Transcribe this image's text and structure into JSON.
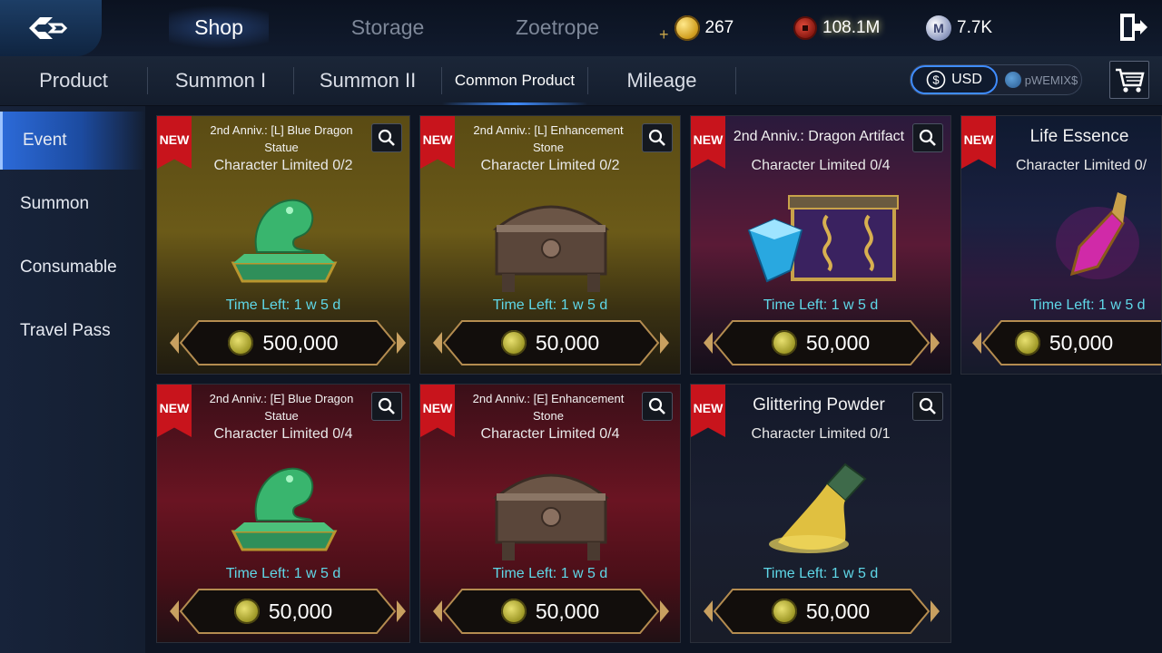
{
  "top_tabs": [
    "Shop",
    "Storage",
    "Zoetrope"
  ],
  "currencies": {
    "gold": "267",
    "red": "108.1M",
    "silver": "7.7K",
    "silver_glyph": "M",
    "gold_plus": "+"
  },
  "sub_tabs": [
    "Product",
    "Summon I",
    "Summon II",
    "Common Product",
    "Mileage"
  ],
  "currency_toggle": {
    "usd": "USD",
    "wemix": "pWEMIX$"
  },
  "sidebar": [
    "Event",
    "Summon",
    "Consumable",
    "Travel Pass"
  ],
  "badge": "NEW",
  "cards": [
    {
      "title": "2nd Anniv.: [L] Blue Dragon Statue",
      "limit": "Character Limited 0/2",
      "time": "Time Left: 1 w 5 d",
      "price": "500,000",
      "icon": "jade-dragon-statue"
    },
    {
      "title": "2nd Anniv.: [L] Enhancement Stone",
      "limit": "Character Limited 0/2",
      "time": "Time Left: 1 w 5 d",
      "price": "50,000",
      "icon": "bronze-chest"
    },
    {
      "title": "2nd Anniv.: Dragon Artifact",
      "limit": "Character Limited 0/4",
      "time": "Time Left: 1 w 5 d",
      "price": "50,000",
      "icon": "gem-and-dragon-chest"
    },
    {
      "title": "Life Essence",
      "limit": "Character Limited 0/",
      "time": "Time Left: 1 w 5 d",
      "price": "50,000",
      "icon": "potion-vial"
    },
    {
      "title": "2nd Anniv.: [E] Blue Dragon Statue",
      "limit": "Character Limited 0/4",
      "time": "Time Left: 1 w 5 d",
      "price": "50,000",
      "icon": "jade-dragon-statue"
    },
    {
      "title": "2nd Anniv.: [E] Enhancement Stone",
      "limit": "Character Limited 0/4",
      "time": "Time Left: 1 w 5 d",
      "price": "50,000",
      "icon": "bronze-chest"
    },
    {
      "title": "Glittering Powder",
      "limit": "Character Limited 0/1",
      "time": "Time Left: 1 w 5 d",
      "price": "50,000",
      "icon": "powder-tube"
    }
  ],
  "colors": {
    "accent": "#3f8cff",
    "time_text": "#5fd8e8",
    "new_badge": "#c8141c"
  }
}
